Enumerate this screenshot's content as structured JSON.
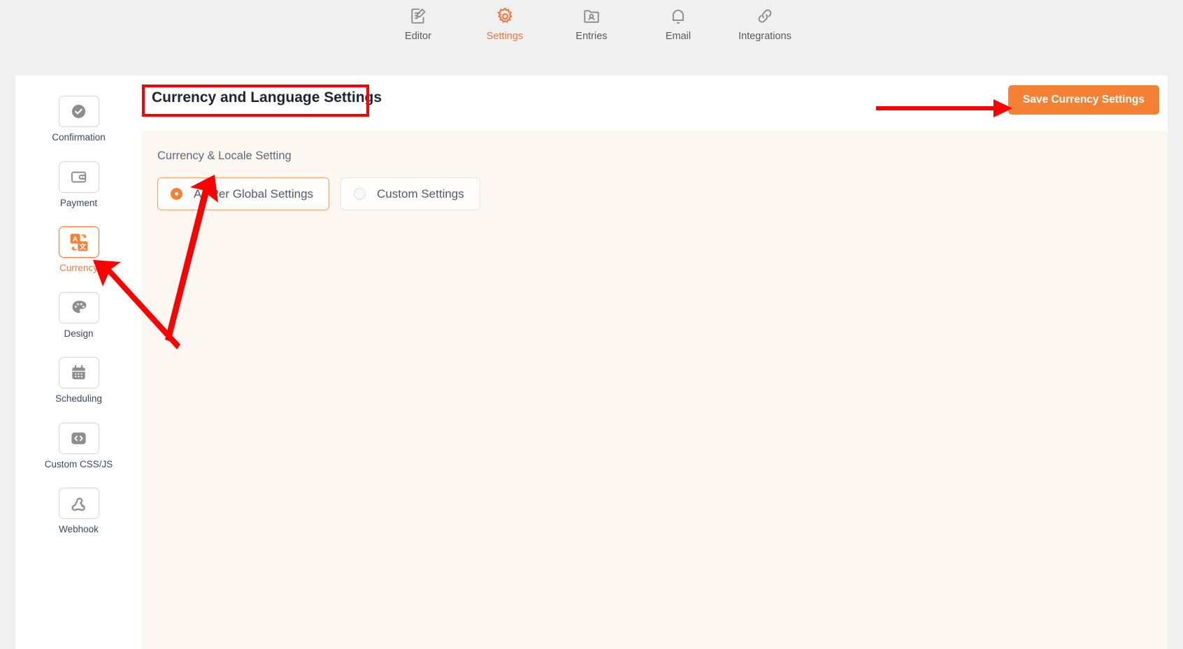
{
  "topnav": {
    "items": [
      {
        "label": "Editor",
        "icon": "editor-icon",
        "active": false
      },
      {
        "label": "Settings",
        "icon": "gear-icon",
        "active": true
      },
      {
        "label": "Entries",
        "icon": "entries-icon",
        "active": false
      },
      {
        "label": "Email",
        "icon": "bell-icon",
        "active": false
      },
      {
        "label": "Integrations",
        "icon": "link-icon",
        "active": false
      }
    ]
  },
  "sidebar": {
    "items": [
      {
        "label": "Confirmation",
        "icon": "check-circle-icon",
        "active": false
      },
      {
        "label": "Payment",
        "icon": "wallet-icon",
        "active": false
      },
      {
        "label": "Currency",
        "icon": "translate-icon",
        "active": true
      },
      {
        "label": "Design",
        "icon": "palette-icon",
        "active": false
      },
      {
        "label": "Scheduling",
        "icon": "calendar-icon",
        "active": false
      },
      {
        "label": "Custom CSS/JS",
        "icon": "code-icon",
        "active": false
      },
      {
        "label": "Webhook",
        "icon": "webhook-icon",
        "active": false
      }
    ]
  },
  "header": {
    "title": "Currency and Language Settings",
    "save_label": "Save Currency Settings"
  },
  "panel": {
    "section_label": "Currency & Locale Setting",
    "options": [
      {
        "label": "As Per Global Settings",
        "selected": true
      },
      {
        "label": "Custom Settings",
        "selected": false
      }
    ]
  },
  "colors": {
    "accent": "#f58134",
    "accent_text": "#f4743b",
    "annotation": "#fa0000",
    "panel_bg": "#fdf7f2",
    "page_bg": "#f0f0f0"
  }
}
